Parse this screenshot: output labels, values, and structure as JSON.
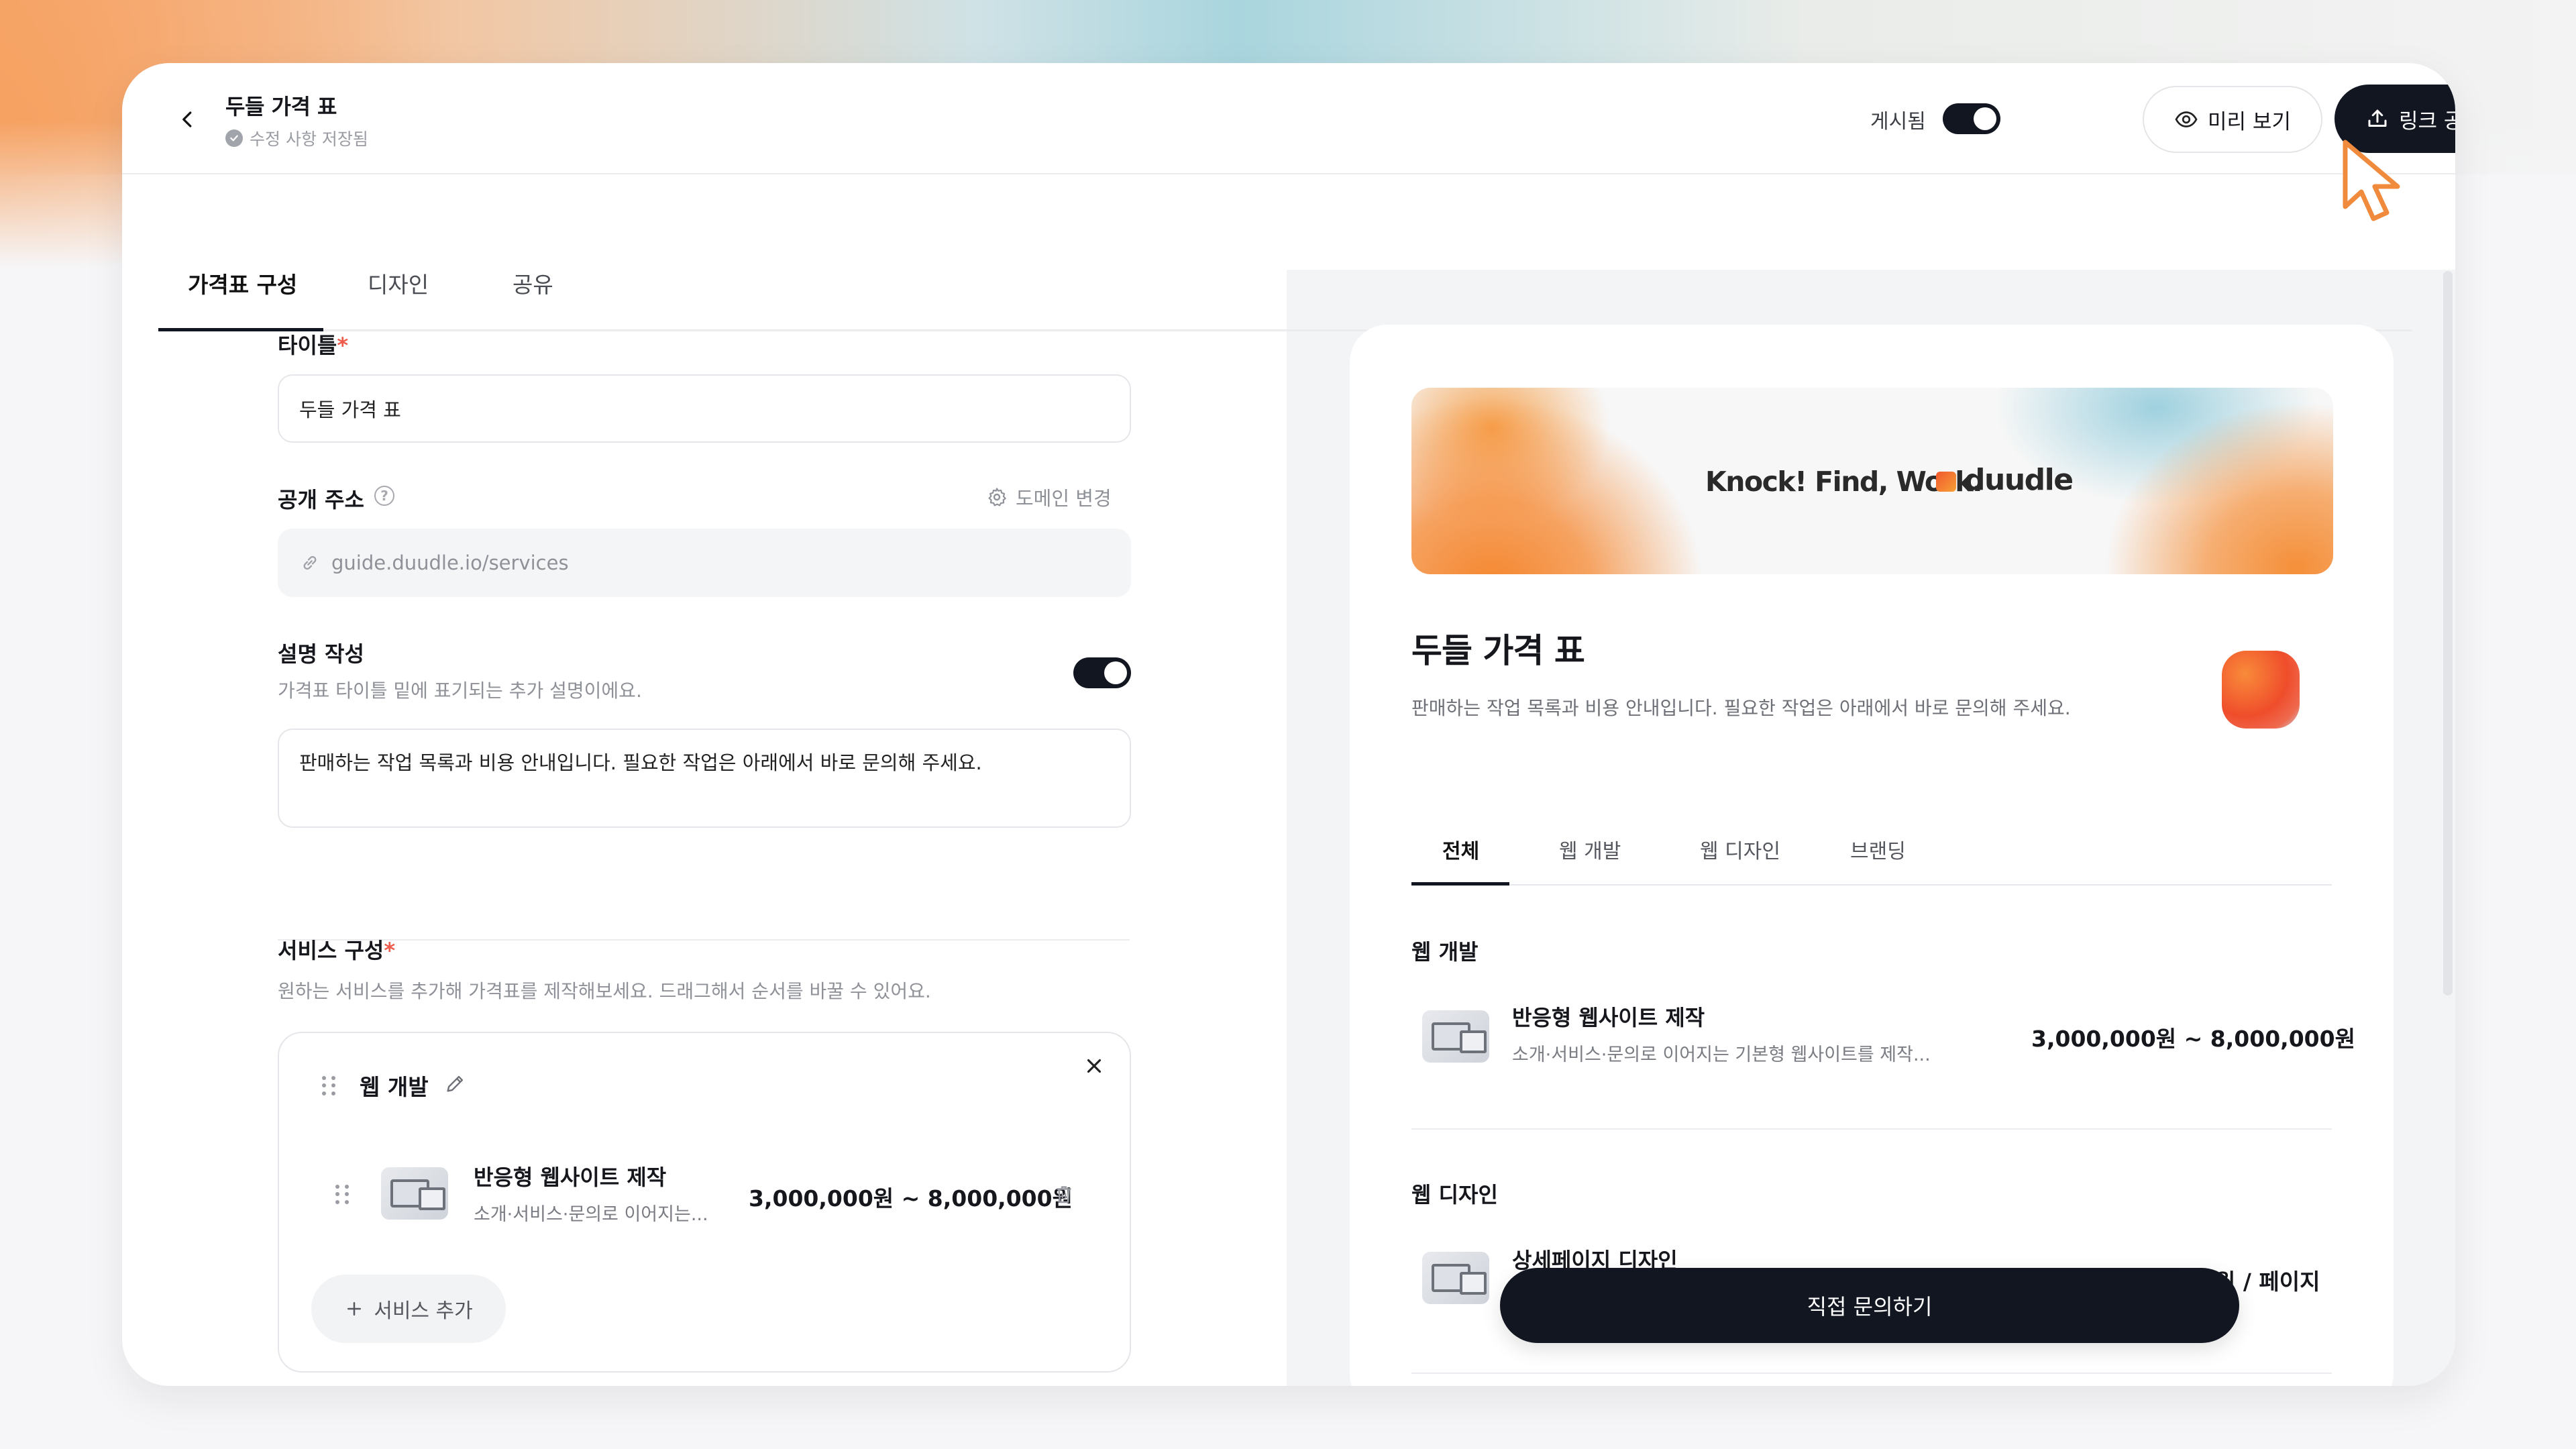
{
  "header": {
    "title": "두들 가격 표",
    "save_status": "수정 사항 저장됨",
    "publish_label": "게시됨",
    "publish_on": true,
    "preview_label": "미리 보기",
    "share_label": "링크 공유"
  },
  "tabs": [
    {
      "label": "가격표 구성",
      "active": true
    },
    {
      "label": "디자인",
      "active": false
    },
    {
      "label": "공유",
      "active": false
    }
  ],
  "form": {
    "title_label": "타이틀",
    "title_value": "두들 가격 표",
    "address_label": "공개 주소",
    "domain_change_label": "도메인 변경",
    "address_value": "guide.duudle.io/services",
    "description_label": "설명 작성",
    "description_help": "가격표 타이틀 밑에 표기되는 추가 설명이에요.",
    "description_on": true,
    "description_value": "판매하는 작업 목록과 비용 안내입니다. 필요한 작업은 아래에서 바로 문의해 주세요.",
    "services_label": "서비스 구성",
    "services_help": "원하는 서비스를 추가해 가격표를 제작해보세요. 드래그해서 순서를 바꿀 수 있어요.",
    "category": {
      "name": "웹 개발",
      "item": {
        "title": "반응형 웹사이트 제작",
        "desc": "소개·서비스·문의로 이어지는...",
        "price": "3,000,000원 ~ 8,000,000원"
      }
    },
    "add_service_label": "서비스 추가"
  },
  "preview": {
    "banner_text": "Knock! Find, Work.",
    "brand_name": "duudle",
    "title": "두들 가격 표",
    "description": "판매하는 작업 목록과 비용 안내입니다. 필요한 작업은 아래에서 바로 문의해 주세요.",
    "tabs": [
      {
        "label": "전체",
        "active": true
      },
      {
        "label": "웹 개발",
        "active": false
      },
      {
        "label": "웹 디자인",
        "active": false
      },
      {
        "label": "브랜딩",
        "active": false
      }
    ],
    "sections": [
      {
        "name": "웹 개발",
        "item_title": "반응형 웹사이트 제작",
        "item_desc": "소개·서비스·문의로 이어지는 기본형 웹사이트를 제작...",
        "item_price": "3,000,000원 ~ 8,000,000원"
      },
      {
        "name": "웹 디자인",
        "item_title": "상세페이지 디자인",
        "item_price": "원 / 페이지"
      }
    ],
    "cta_label": "직접 문의하기"
  },
  "colors": {
    "primary": "#111621",
    "required": "#ef5a4a",
    "accent_orange": "#f5862e"
  }
}
